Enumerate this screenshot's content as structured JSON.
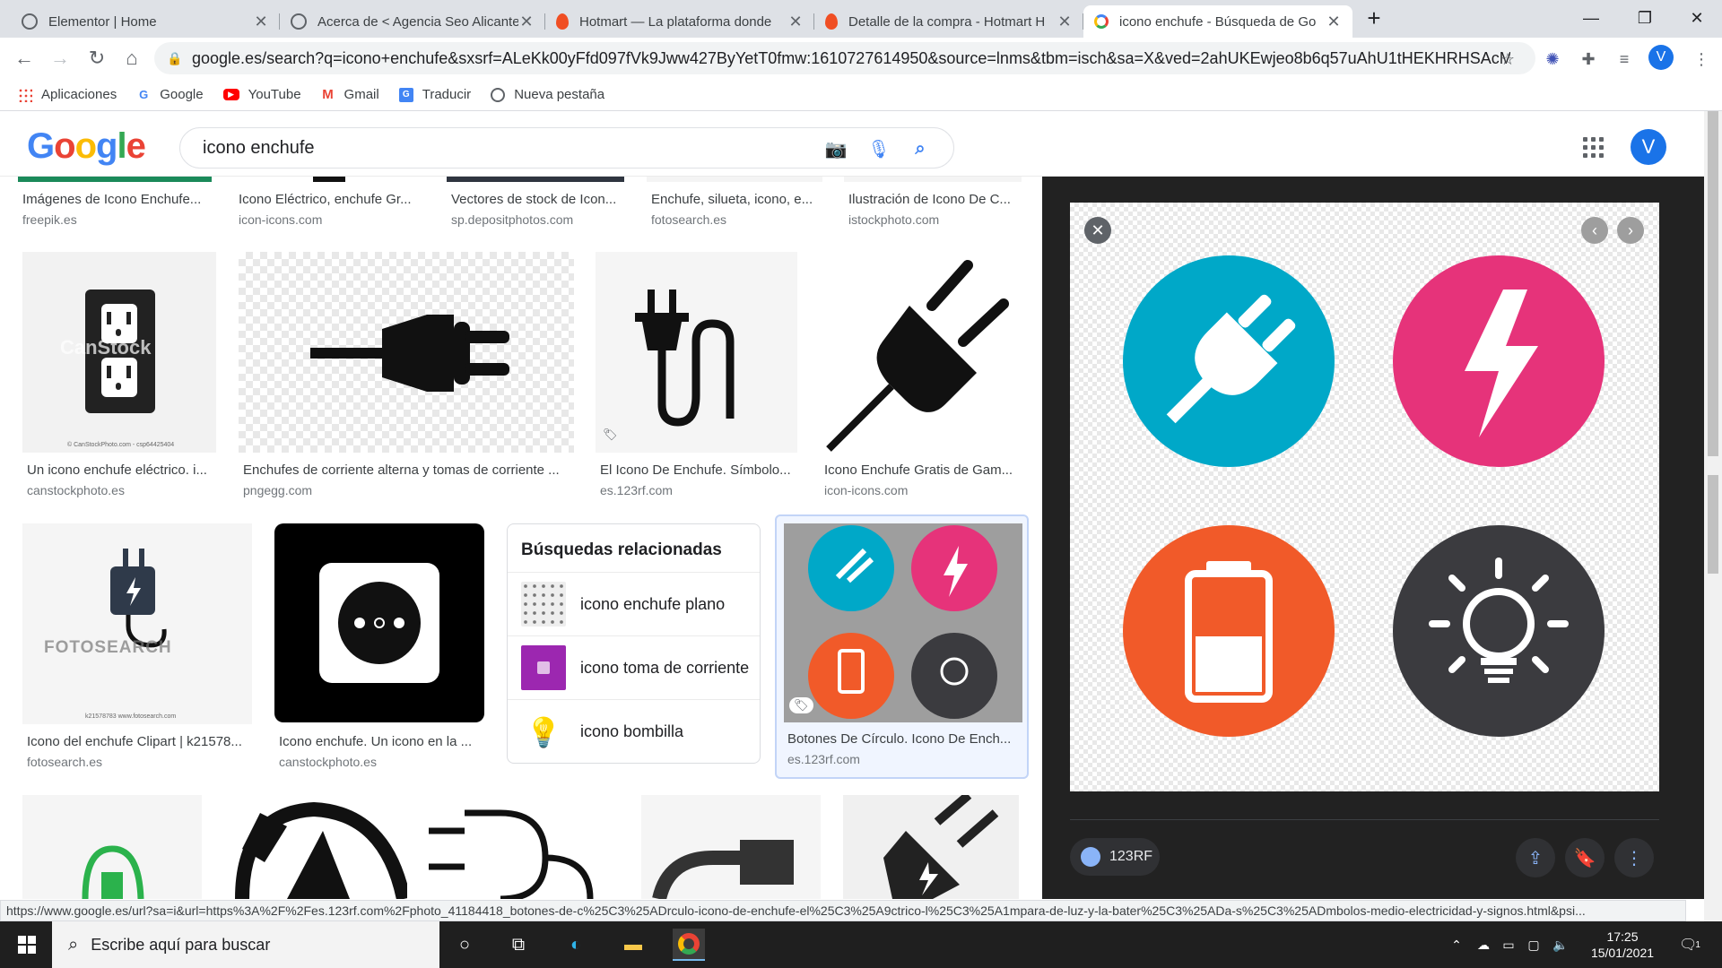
{
  "tabs": [
    {
      "label": "Elementor | Home",
      "icon": "globe-icon"
    },
    {
      "label": "Acerca de < Agencia Seo Alicante",
      "icon": "globe-icon"
    },
    {
      "label": "Hotmart — La plataforma donde",
      "icon": "hotmart-icon"
    },
    {
      "label": "Detalle de la compra - Hotmart H",
      "icon": "hotmart-icon"
    },
    {
      "label": "icono enchufe - Búsqueda de Go",
      "icon": "google-icon"
    }
  ],
  "address": {
    "url": "google.es/search?q=icono+enchufe&sxsrf=ALeKk00yFfd097fVk9Jww427ByYetT0fmw:1610727614950&source=lnms&tbm=isch&sa=X&ved=2ahUKEwjeo8b6q57uAhU1tHEKHRHSAcMQ..."
  },
  "profile_initial": "V",
  "bookmarks": [
    {
      "label": "Aplicaciones",
      "icon": "apps-grid-icon"
    },
    {
      "label": "Google",
      "icon": "google-g-icon"
    },
    {
      "label": "YouTube",
      "icon": "youtube-icon"
    },
    {
      "label": "Gmail",
      "icon": "gmail-icon"
    },
    {
      "label": "Traducir",
      "icon": "translate-icon"
    },
    {
      "label": "Nueva pestaña",
      "icon": "globe-icon"
    }
  ],
  "search": {
    "logo": "Google",
    "query": "icono enchufe"
  },
  "top_row": [
    {
      "title": "Imágenes de Icono Enchufe...",
      "source": "freepik.es"
    },
    {
      "title": "Icono Eléctrico, enchufe Gr...",
      "source": "icon-icons.com"
    },
    {
      "title": "Vectores de stock de Icon...",
      "source": "sp.depositphotos.com"
    },
    {
      "title": "Enchufe, silueta, icono, e...",
      "source": "fotosearch.es"
    },
    {
      "title": "Ilustración de Icono De C...",
      "source": "istockphoto.com"
    }
  ],
  "row2": [
    {
      "title": "Un icono enchufe eléctrico. i...",
      "source": "canstockphoto.es"
    },
    {
      "title": "Enchufes de corriente alterna y tomas de corriente ...",
      "source": "pngegg.com"
    },
    {
      "title": "El Icono De Enchufe. Símbolo...",
      "source": "es.123rf.com"
    },
    {
      "title": "Icono Enchufe Gratis de Gam...",
      "source": "icon-icons.com"
    }
  ],
  "row3": [
    {
      "title": "Icono del enchufe Clipart | k21578...",
      "source": "fotosearch.es"
    },
    {
      "title": "Icono enchufe. Un icono en la ...",
      "source": "canstockphoto.es"
    },
    {
      "title": "Botones De Círculo. Icono De Ench...",
      "source": "es.123rf.com"
    }
  ],
  "watermarks": {
    "canstock": "CanStock",
    "canstock_small": "© CanStockPhoto.com - csp64425404",
    "fotosearch": "FOTOSEARCH",
    "fotosearch_small": "k21578783 www.fotosearch.com"
  },
  "related": {
    "heading": "Búsquedas relacionadas",
    "items": [
      {
        "label": "icono enchufe plano"
      },
      {
        "label": "icono toma de corriente"
      },
      {
        "label": "icono bombilla"
      }
    ]
  },
  "panel": {
    "source_label": "123RF",
    "colors": {
      "plug": "#00a8c8",
      "bolt": "#e6337a",
      "battery": "#f15a29",
      "bulb": "#3b3b3f"
    }
  },
  "status_url": "https://www.google.es/url?sa=i&url=https%3A%2F%2Fes.123rf.com%2Fphoto_41184418_botones-de-c%25C3%25ADrculo-icono-de-enchufe-el%25C3%25A9ctrico-l%25C3%25A1mpara-de-luz-y-la-bater%25C3%25ADa-s%25C3%25ADmbolos-medio-electricidad-y-signos.html&psi...",
  "taskbar": {
    "search_placeholder": "Escribe aquí para buscar",
    "time": "17:25",
    "date": "15/01/2021",
    "notifications": "1"
  }
}
